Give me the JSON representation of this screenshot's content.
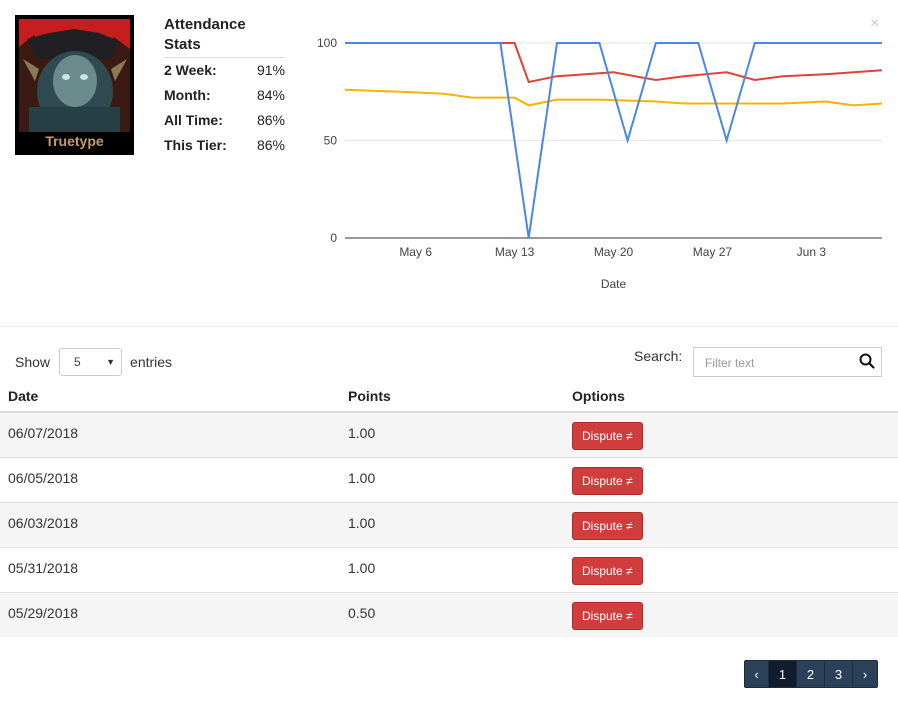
{
  "close_label": "×",
  "character": {
    "name": "Truetype",
    "name_color": "#c69b6d"
  },
  "stats": {
    "title": "Attendance Stats",
    "rows": [
      {
        "label": "2 Week:",
        "value": "91%"
      },
      {
        "label": "Month:",
        "value": "84%"
      },
      {
        "label": "All Time:",
        "value": "86%"
      },
      {
        "label": "This Tier:",
        "value": "86%"
      }
    ]
  },
  "chart_data": {
    "type": "line",
    "xlabel": "Date",
    "ylabel": "",
    "ylim": [
      0,
      100
    ],
    "yticks": [
      0,
      50,
      100
    ],
    "xticks": [
      {
        "label": "May 6",
        "x": "2018-05-06"
      },
      {
        "label": "May 13",
        "x": "2018-05-13"
      },
      {
        "label": "May 20",
        "x": "2018-05-20"
      },
      {
        "label": "May 27",
        "x": "2018-05-27"
      },
      {
        "label": "Jun 3",
        "x": "2018-06-03"
      }
    ],
    "xlim": [
      "2018-05-01",
      "2018-06-08"
    ],
    "grid": true,
    "series": [
      {
        "color": "#db4437",
        "x": [
          "2018-05-01",
          "2018-05-13",
          "2018-05-14",
          "2018-05-16",
          "2018-05-20",
          "2018-05-23",
          "2018-05-25",
          "2018-05-28",
          "2018-05-30",
          "2018-06-01",
          "2018-06-04",
          "2018-06-08"
        ],
        "values": [
          100,
          100,
          80,
          83,
          85,
          81,
          83,
          85,
          81,
          83,
          84,
          86
        ]
      },
      {
        "color": "#f4b400",
        "x": [
          "2018-05-01",
          "2018-05-05",
          "2018-05-08",
          "2018-05-10",
          "2018-05-13",
          "2018-05-14",
          "2018-05-16",
          "2018-05-19",
          "2018-05-23",
          "2018-05-25",
          "2018-05-28",
          "2018-05-30",
          "2018-06-01",
          "2018-06-04",
          "2018-06-06",
          "2018-06-08"
        ],
        "values": [
          76,
          75,
          74,
          72,
          72,
          68,
          71,
          71,
          70,
          69,
          69,
          69,
          69,
          70,
          68,
          69
        ]
      },
      {
        "color": "#4a86e8",
        "x": [
          "2018-05-01",
          "2018-05-12",
          "2018-05-14",
          "2018-05-16",
          "2018-05-19",
          "2018-05-21",
          "2018-05-23",
          "2018-05-26",
          "2018-05-28",
          "2018-05-30",
          "2018-06-08"
        ],
        "values": [
          100,
          100,
          0,
          100,
          100,
          50,
          100,
          100,
          50,
          100,
          100
        ]
      }
    ]
  },
  "length": {
    "show_label": "Show",
    "value": "5",
    "entries_label": "entries"
  },
  "search": {
    "label": "Search:",
    "placeholder": "Filter text"
  },
  "table": {
    "headers": {
      "date": "Date",
      "points": "Points",
      "options": "Options"
    },
    "rows": [
      {
        "date": "06/07/2018",
        "points": "1.00",
        "action": "Dispute ≠"
      },
      {
        "date": "06/05/2018",
        "points": "1.00",
        "action": "Dispute ≠"
      },
      {
        "date": "06/03/2018",
        "points": "1.00",
        "action": "Dispute ≠"
      },
      {
        "date": "05/31/2018",
        "points": "1.00",
        "action": "Dispute ≠"
      },
      {
        "date": "05/29/2018",
        "points": "0.50",
        "action": "Dispute ≠"
      }
    ]
  },
  "pagination": {
    "prev": "‹",
    "pages": [
      "1",
      "2",
      "3"
    ],
    "active": "1",
    "next": "›"
  }
}
